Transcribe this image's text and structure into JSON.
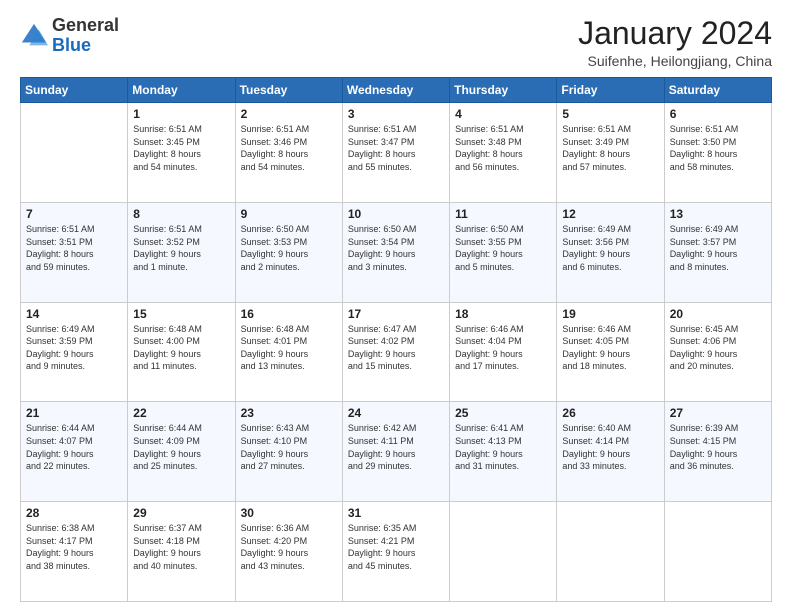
{
  "header": {
    "logo": {
      "general": "General",
      "blue": "Blue"
    },
    "title": "January 2024",
    "subtitle": "Suifenhe, Heilongjiang, China"
  },
  "weekdays": [
    "Sunday",
    "Monday",
    "Tuesday",
    "Wednesday",
    "Thursday",
    "Friday",
    "Saturday"
  ],
  "weeks": [
    [
      {
        "day": "",
        "info": ""
      },
      {
        "day": "1",
        "info": "Sunrise: 6:51 AM\nSunset: 3:45 PM\nDaylight: 8 hours\nand 54 minutes."
      },
      {
        "day": "2",
        "info": "Sunrise: 6:51 AM\nSunset: 3:46 PM\nDaylight: 8 hours\nand 54 minutes."
      },
      {
        "day": "3",
        "info": "Sunrise: 6:51 AM\nSunset: 3:47 PM\nDaylight: 8 hours\nand 55 minutes."
      },
      {
        "day": "4",
        "info": "Sunrise: 6:51 AM\nSunset: 3:48 PM\nDaylight: 8 hours\nand 56 minutes."
      },
      {
        "day": "5",
        "info": "Sunrise: 6:51 AM\nSunset: 3:49 PM\nDaylight: 8 hours\nand 57 minutes."
      },
      {
        "day": "6",
        "info": "Sunrise: 6:51 AM\nSunset: 3:50 PM\nDaylight: 8 hours\nand 58 minutes."
      }
    ],
    [
      {
        "day": "7",
        "info": "Sunrise: 6:51 AM\nSunset: 3:51 PM\nDaylight: 8 hours\nand 59 minutes."
      },
      {
        "day": "8",
        "info": "Sunrise: 6:51 AM\nSunset: 3:52 PM\nDaylight: 9 hours\nand 1 minute."
      },
      {
        "day": "9",
        "info": "Sunrise: 6:50 AM\nSunset: 3:53 PM\nDaylight: 9 hours\nand 2 minutes."
      },
      {
        "day": "10",
        "info": "Sunrise: 6:50 AM\nSunset: 3:54 PM\nDaylight: 9 hours\nand 3 minutes."
      },
      {
        "day": "11",
        "info": "Sunrise: 6:50 AM\nSunset: 3:55 PM\nDaylight: 9 hours\nand 5 minutes."
      },
      {
        "day": "12",
        "info": "Sunrise: 6:49 AM\nSunset: 3:56 PM\nDaylight: 9 hours\nand 6 minutes."
      },
      {
        "day": "13",
        "info": "Sunrise: 6:49 AM\nSunset: 3:57 PM\nDaylight: 9 hours\nand 8 minutes."
      }
    ],
    [
      {
        "day": "14",
        "info": "Sunrise: 6:49 AM\nSunset: 3:59 PM\nDaylight: 9 hours\nand 9 minutes."
      },
      {
        "day": "15",
        "info": "Sunrise: 6:48 AM\nSunset: 4:00 PM\nDaylight: 9 hours\nand 11 minutes."
      },
      {
        "day": "16",
        "info": "Sunrise: 6:48 AM\nSunset: 4:01 PM\nDaylight: 9 hours\nand 13 minutes."
      },
      {
        "day": "17",
        "info": "Sunrise: 6:47 AM\nSunset: 4:02 PM\nDaylight: 9 hours\nand 15 minutes."
      },
      {
        "day": "18",
        "info": "Sunrise: 6:46 AM\nSunset: 4:04 PM\nDaylight: 9 hours\nand 17 minutes."
      },
      {
        "day": "19",
        "info": "Sunrise: 6:46 AM\nSunset: 4:05 PM\nDaylight: 9 hours\nand 18 minutes."
      },
      {
        "day": "20",
        "info": "Sunrise: 6:45 AM\nSunset: 4:06 PM\nDaylight: 9 hours\nand 20 minutes."
      }
    ],
    [
      {
        "day": "21",
        "info": "Sunrise: 6:44 AM\nSunset: 4:07 PM\nDaylight: 9 hours\nand 22 minutes."
      },
      {
        "day": "22",
        "info": "Sunrise: 6:44 AM\nSunset: 4:09 PM\nDaylight: 9 hours\nand 25 minutes."
      },
      {
        "day": "23",
        "info": "Sunrise: 6:43 AM\nSunset: 4:10 PM\nDaylight: 9 hours\nand 27 minutes."
      },
      {
        "day": "24",
        "info": "Sunrise: 6:42 AM\nSunset: 4:11 PM\nDaylight: 9 hours\nand 29 minutes."
      },
      {
        "day": "25",
        "info": "Sunrise: 6:41 AM\nSunset: 4:13 PM\nDaylight: 9 hours\nand 31 minutes."
      },
      {
        "day": "26",
        "info": "Sunrise: 6:40 AM\nSunset: 4:14 PM\nDaylight: 9 hours\nand 33 minutes."
      },
      {
        "day": "27",
        "info": "Sunrise: 6:39 AM\nSunset: 4:15 PM\nDaylight: 9 hours\nand 36 minutes."
      }
    ],
    [
      {
        "day": "28",
        "info": "Sunrise: 6:38 AM\nSunset: 4:17 PM\nDaylight: 9 hours\nand 38 minutes."
      },
      {
        "day": "29",
        "info": "Sunrise: 6:37 AM\nSunset: 4:18 PM\nDaylight: 9 hours\nand 40 minutes."
      },
      {
        "day": "30",
        "info": "Sunrise: 6:36 AM\nSunset: 4:20 PM\nDaylight: 9 hours\nand 43 minutes."
      },
      {
        "day": "31",
        "info": "Sunrise: 6:35 AM\nSunset: 4:21 PM\nDaylight: 9 hours\nand 45 minutes."
      },
      {
        "day": "",
        "info": ""
      },
      {
        "day": "",
        "info": ""
      },
      {
        "day": "",
        "info": ""
      }
    ]
  ]
}
